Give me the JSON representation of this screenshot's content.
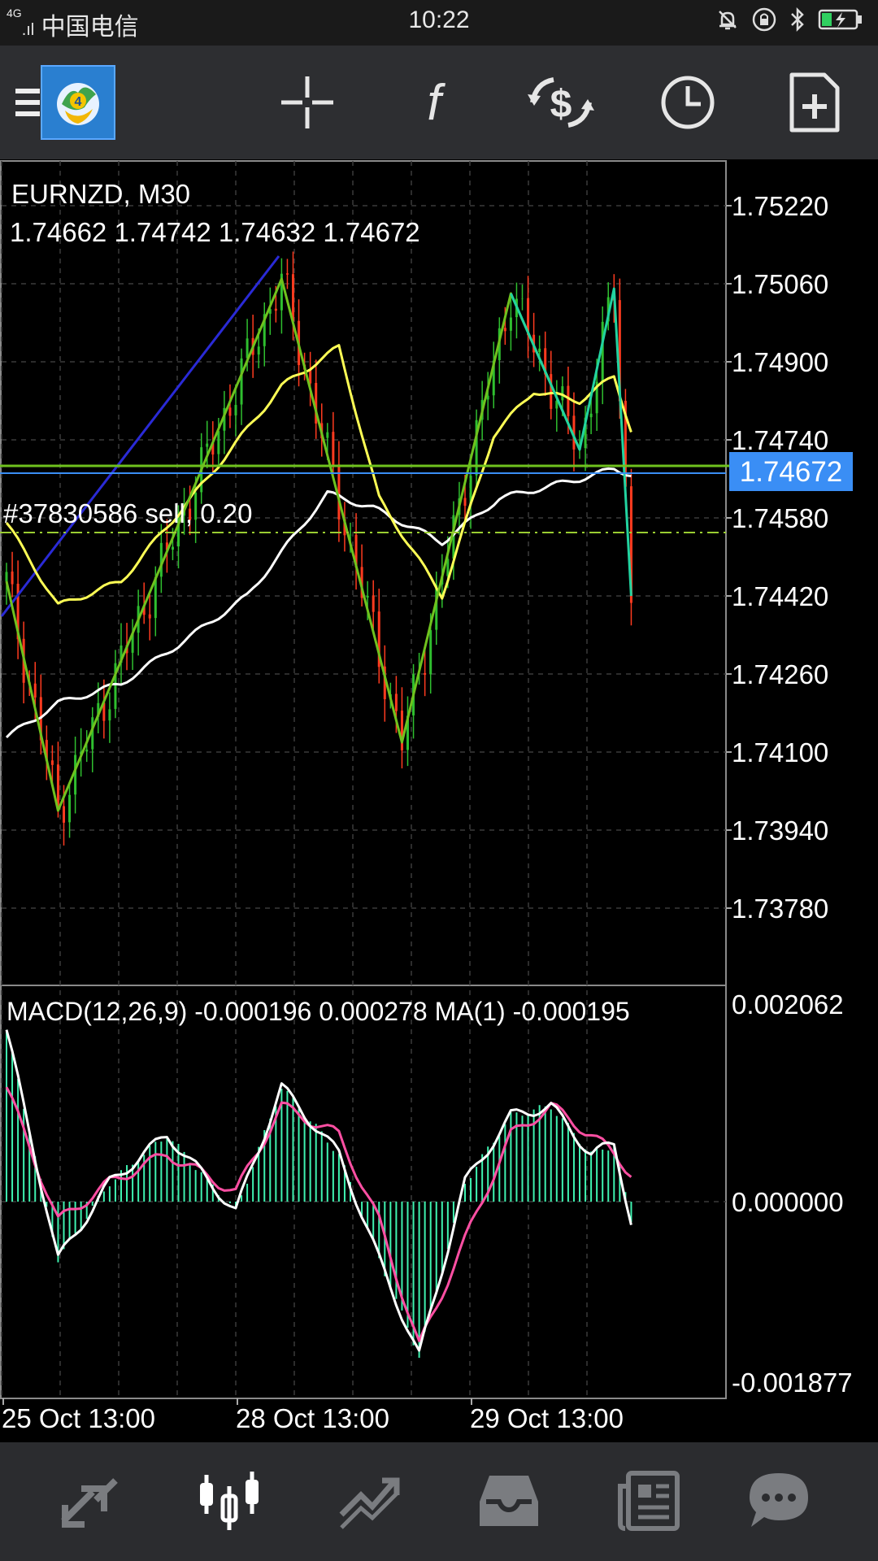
{
  "status_bar": {
    "network": "4G",
    "carrier": "中国电信",
    "time": "10:22",
    "icons": [
      "mute-icon",
      "lock-rotation-icon",
      "bluetooth-icon",
      "battery-charging-icon"
    ]
  },
  "toolbar": {
    "items": [
      "menu-icon",
      "app-logo-icon",
      "crosshair-icon",
      "indicators-icon",
      "trade-icon",
      "timeframe-icon",
      "new-order-icon"
    ],
    "logo_badge": "4"
  },
  "chart": {
    "symbol": "EURNZD, M30",
    "ohlc": "1.74662 1.74742 1.74632 1.74672",
    "order_label": "#37830586 sell, 0.20",
    "current_price": "1.74672",
    "price_ticks": [
      "1.75220",
      "1.75060",
      "1.74900",
      "1.74740",
      "1.74580",
      "1.74420",
      "1.74260",
      "1.74100",
      "1.73940",
      "1.73780"
    ],
    "macd_label": "MACD(12,26,9) -0.000196 0.000278 MA(1) -0.000195",
    "macd_ticks": [
      "0.002062",
      "0.000000",
      "-0.001877"
    ],
    "time_ticks": [
      "25 Oct 13:00",
      "28 Oct 13:00",
      "29 Oct 13:00"
    ],
    "colors": {
      "bull_candle": "#2fbf2f",
      "bear_candle": "#ff3b1f",
      "ma_fast": "#ffff55",
      "ma_slow": "#ffffff",
      "zigzag": "#6fc21e",
      "trendline": "#2a2ad6",
      "zigzag_recent": "#22d3a0",
      "macd_hist": "#3ff2b0",
      "macd_signal": "#ff4fa3",
      "price_tag": "#3a8ef5"
    }
  },
  "chart_data": {
    "type": "line",
    "title": "EURNZD, M30",
    "ylim": [
      1.737,
      1.753
    ],
    "series": [
      {
        "name": "ZigZag",
        "points": [
          [
            0,
            1.7445
          ],
          [
            9,
            1.7398
          ],
          [
            48,
            1.7507
          ],
          [
            69,
            1.7412
          ],
          [
            88,
            1.7504
          ],
          [
            100,
            1.7472
          ],
          [
            106,
            1.7505
          ],
          [
            109,
            1.7442
          ]
        ]
      },
      {
        "name": "",
        "points": [
          [
            0,
            1.7457
          ],
          [
            9,
            1.744
          ],
          [
            20,
            1.7445
          ],
          [
            35,
            1.7466
          ],
          [
            48,
            1.7485
          ],
          [
            58,
            1.7493
          ],
          [
            65,
            1.7462
          ],
          [
            76,
            1.7442
          ],
          [
            85,
            1.7475
          ],
          [
            92,
            1.7484
          ],
          [
            100,
            1.7482
          ],
          [
            106,
            1.7487
          ],
          [
            109,
            1.7476
          ]
        ]
      },
      {
        "name": "",
        "points": [
          [
            0,
            1.7413
          ],
          [
            9,
            1.742
          ],
          [
            20,
            1.7424
          ],
          [
            30,
            1.7432
          ],
          [
            42,
            1.7442
          ],
          [
            56,
            1.7463
          ],
          [
            64,
            1.746
          ],
          [
            76,
            1.7453
          ],
          [
            86,
            1.7462
          ],
          [
            100,
            1.7466
          ],
          [
            106,
            1.7468
          ],
          [
            109,
            1.7467
          ]
        ]
      }
    ],
    "macd": {
      "ylim": [
        -0.001877,
        0.002062
      ],
      "main": [
        [
          0,
          0.0018
        ],
        [
          9,
          -0.0006
        ],
        [
          18,
          0.0002
        ],
        [
          28,
          0.0007
        ],
        [
          40,
          -0.0001
        ],
        [
          48,
          0.0012
        ],
        [
          58,
          0.0005
        ],
        [
          65,
          -0.0006
        ],
        [
          72,
          -0.0016
        ],
        [
          80,
          0.0002
        ],
        [
          88,
          0.0009
        ],
        [
          95,
          0.001
        ],
        [
          102,
          0.0005
        ],
        [
          106,
          0.0006
        ],
        [
          109,
          -0.0002
        ]
      ],
      "signal": [
        [
          0,
          0.0012
        ],
        [
          9,
          -0.0002
        ],
        [
          18,
          0.0002
        ],
        [
          28,
          0.0005
        ],
        [
          40,
          0.0001
        ],
        [
          48,
          0.001
        ],
        [
          58,
          0.0007
        ],
        [
          65,
          -0.0002
        ],
        [
          72,
          -0.0015
        ],
        [
          80,
          -0.0004
        ],
        [
          88,
          0.0007
        ],
        [
          95,
          0.001
        ],
        [
          102,
          0.0007
        ],
        [
          106,
          0.0005
        ],
        [
          109,
          0.0003
        ]
      ]
    }
  },
  "bottom_nav": {
    "items": [
      "quotes-icon",
      "chart-icon",
      "trade-icon",
      "history-icon",
      "news-icon",
      "chat-icon"
    ],
    "active": "chart-icon"
  }
}
